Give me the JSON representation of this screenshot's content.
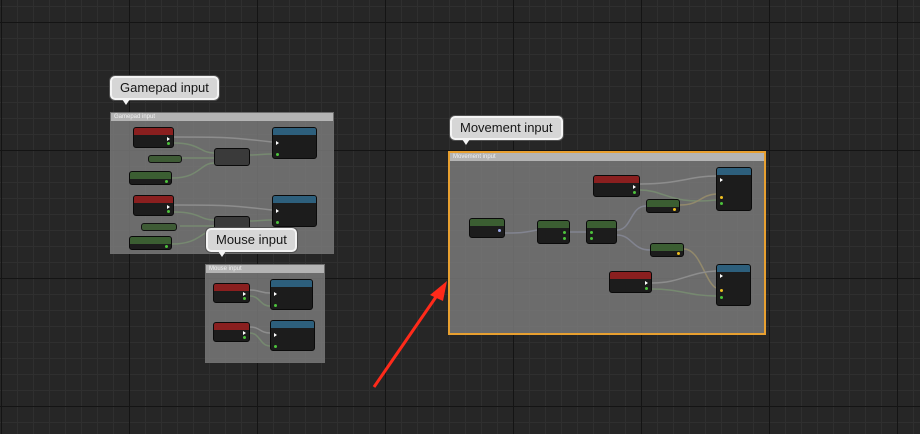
{
  "comments": {
    "gamepad": {
      "title": "Gamepad input",
      "header": "Gamepad input"
    },
    "mouse": {
      "title": "Mouse input",
      "header": "Mouse input"
    },
    "movement": {
      "title": "Movement input",
      "header": "Movement input"
    }
  },
  "colors": {
    "selection": "#e8a030",
    "annotation_arrow": "#ff2a1a",
    "exec_wire": "#d8d8d8",
    "float_wire": "#5bc43a",
    "vector_wire": "#f0c020",
    "struct_wire": "#9aa6e8"
  },
  "icons": [
    "annotation-arrow-icon"
  ]
}
